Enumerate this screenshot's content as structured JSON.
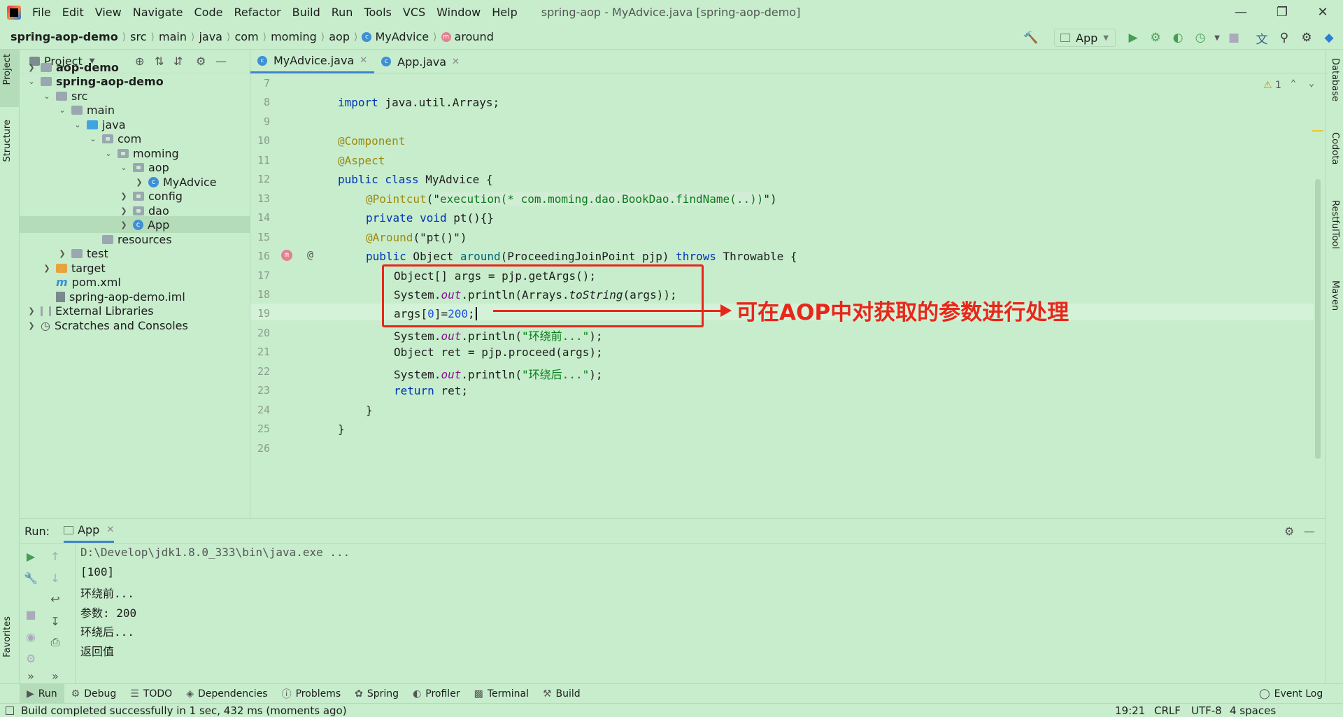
{
  "window": {
    "menu": [
      "File",
      "Edit",
      "View",
      "Navigate",
      "Code",
      "Refactor",
      "Build",
      "Run",
      "Tools",
      "VCS",
      "Window",
      "Help"
    ],
    "title": "spring-aop - MyAdvice.java [spring-aop-demo]"
  },
  "breadcrumb": [
    "spring-aop-demo",
    "src",
    "main",
    "java",
    "com",
    "moming",
    "aop",
    "MyAdvice",
    "around"
  ],
  "toolbar": {
    "run_config": "App"
  },
  "left_strip": {
    "project": "Project",
    "structure": "Structure",
    "favorites": "Favorites"
  },
  "project_panel": {
    "title": "Project",
    "tree": [
      {
        "label": "aop-demo",
        "bold": true
      },
      {
        "label": "spring-aop-demo",
        "bold": true
      },
      {
        "label": "src"
      },
      {
        "label": "main"
      },
      {
        "label": "java"
      },
      {
        "label": "com"
      },
      {
        "label": "moming"
      },
      {
        "label": "aop"
      },
      {
        "label": "MyAdvice"
      },
      {
        "label": "config"
      },
      {
        "label": "dao"
      },
      {
        "label": "App"
      },
      {
        "label": "resources"
      },
      {
        "label": "test"
      },
      {
        "label": "target"
      },
      {
        "label": "pom.xml"
      },
      {
        "label": "spring-aop-demo.iml"
      },
      {
        "label": "External Libraries"
      },
      {
        "label": "Scratches and Consoles"
      }
    ]
  },
  "editor_tabs": [
    "MyAdvice.java",
    "App.java"
  ],
  "editor": {
    "warning_count": "1",
    "line_numbers": [
      "7",
      "8",
      "9",
      "10",
      "11",
      "12",
      "13",
      "14",
      "15",
      "16",
      "17",
      "18",
      "19",
      "20",
      "21",
      "22",
      "23",
      "24",
      "25",
      "26"
    ],
    "lines": {
      "l8_kw": "import",
      "l8_rest": " java.util.Arrays;",
      "l10": "@Component",
      "l11": "@Aspect",
      "l12_kw": "public class",
      "l12_rest": " MyAdvice {",
      "l13_ann": "@Pointcut",
      "l13_a": "(\"",
      "l13_str": "execution(* com.moming.dao.BookDao.findName(..))",
      "l13_b": "\")",
      "l14_kw": "private void",
      "l14_rest": " pt(){}",
      "l15_ann": "@Around",
      "l15_rest": "(\"pt()\")",
      "l16_kw": "public",
      "l16_a": " Object ",
      "l16_meth": "around",
      "l16_b": "(ProceedingJoinPoint pjp) ",
      "l16_kw2": "throws",
      "l16_c": " Throwable {",
      "l17": "Object[] args = pjp.getArgs();",
      "l18_a": "System.",
      "l18_fld": "out",
      "l18_b": ".println(Arrays.",
      "l18_itl": "toString",
      "l18_c": "(args));",
      "l19_a": "args[",
      "l19_n0": "0",
      "l19_b": "]=",
      "l19_n1": "200",
      "l19_c": ";",
      "l20_a": "System.",
      "l20_fld": "out",
      "l20_b": ".println(",
      "l20_str": "\"环绕前...\"",
      "l20_c": ");",
      "l21": "Object ret = pjp.proceed(args);",
      "l22_a": "System.",
      "l22_fld": "out",
      "l22_b": ".println(",
      "l22_str": "\"环绕后...\"",
      "l22_c": ");",
      "l23_kw": "return",
      "l23_rest": " ret;",
      "l24": "}",
      "l25": "}"
    }
  },
  "annotation": {
    "text": "可在AOP中对获取的参数进行处理"
  },
  "right_strip": [
    "Database",
    "Codota",
    "RestfulTool",
    "Maven"
  ],
  "run_panel": {
    "label": "Run:",
    "tab": "App",
    "console": [
      "D:\\Develop\\jdk1.8.0_333\\bin\\java.exe ...",
      "[100]",
      "环绕前...",
      "参数: 200",
      "环绕后...",
      "返回值"
    ]
  },
  "bottom_tabs": [
    "Run",
    "Debug",
    "TODO",
    "Dependencies",
    "Problems",
    "Spring",
    "Profiler",
    "Terminal",
    "Build",
    "Event Log"
  ],
  "status": {
    "message": "Build completed successfully in 1 sec, 432 ms (moments ago)",
    "position": "19:21",
    "line_sep": "CRLF",
    "encoding": "UTF-8",
    "indent": "4 spaces"
  }
}
